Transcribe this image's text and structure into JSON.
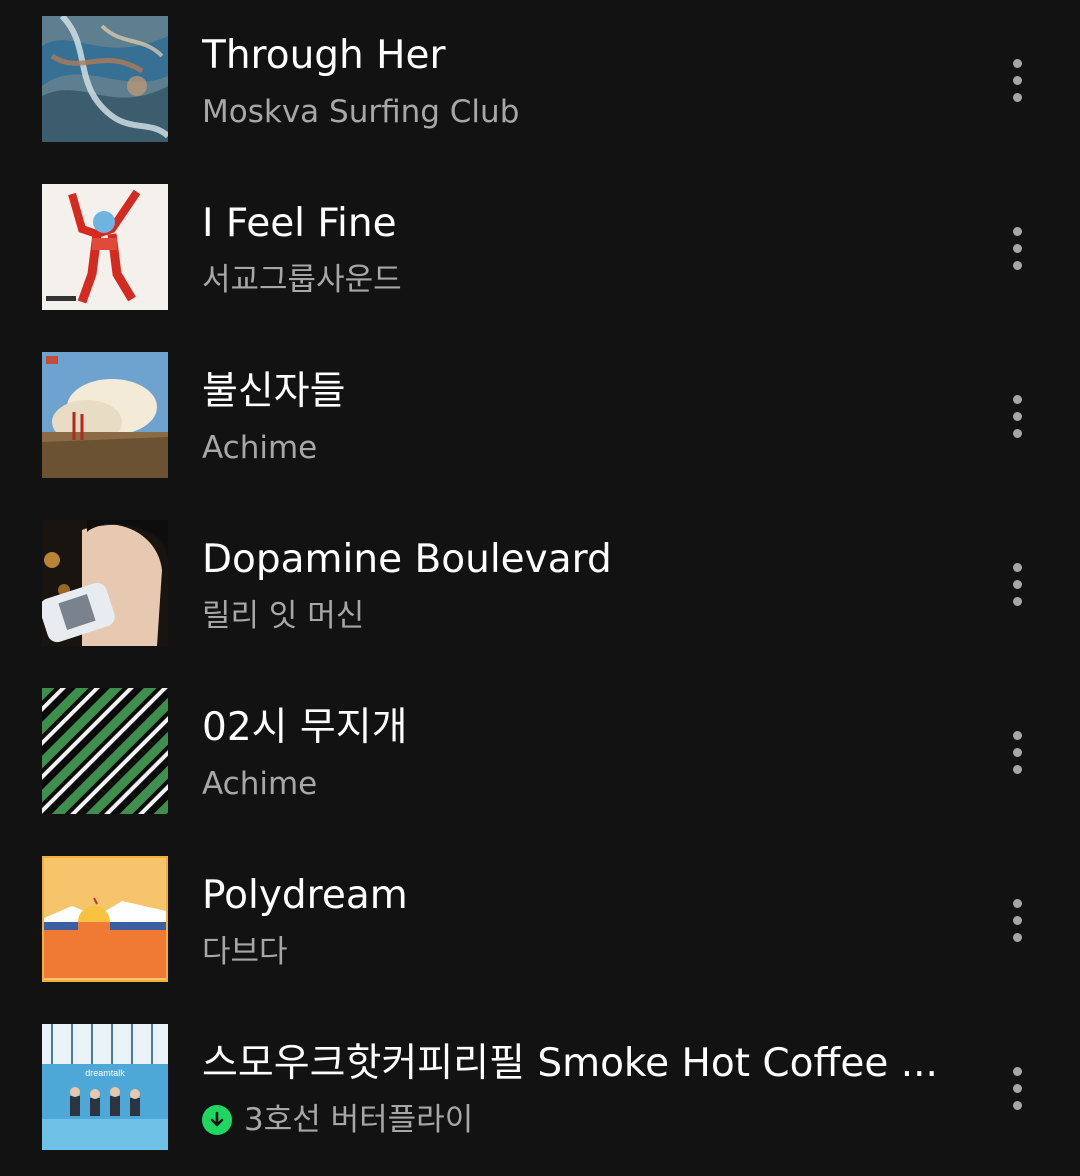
{
  "tracks": [
    {
      "title": "Through Her",
      "artist": "Moskva Surfing Club",
      "art": "album-art-blue-swirl",
      "downloaded": false
    },
    {
      "title": "I Feel Fine",
      "artist": "서교그룹사운드",
      "art": "album-art-red-figure",
      "downloaded": false
    },
    {
      "title": "불신자들",
      "artist": "Achime",
      "art": "album-art-sea-spray",
      "downloaded": false
    },
    {
      "title": "Dopamine Boulevard",
      "artist": "릴리 잇 머신",
      "art": "album-art-drinking-person",
      "downloaded": false
    },
    {
      "title": "02시 무지개",
      "artist": "Achime",
      "art": "album-art-diagonal-pattern",
      "downloaded": false
    },
    {
      "title": "Polydream",
      "artist": "다브다",
      "art": "album-art-orange-sunset",
      "downloaded": false
    },
    {
      "title": "스모우크핫커피리필 Smoke Hot Coffee ...",
      "artist": "3호선 버터플라이",
      "art": "album-art-dreamtalk",
      "downloaded": true,
      "art_text": "dreamtalk"
    }
  ],
  "colors": {
    "background": "#121212",
    "title": "#ffffff",
    "subtitle": "#a7a7a7",
    "download_badge": "#1ed760"
  },
  "icons": {
    "more": "more-vertical-icon",
    "download": "download-icon"
  }
}
